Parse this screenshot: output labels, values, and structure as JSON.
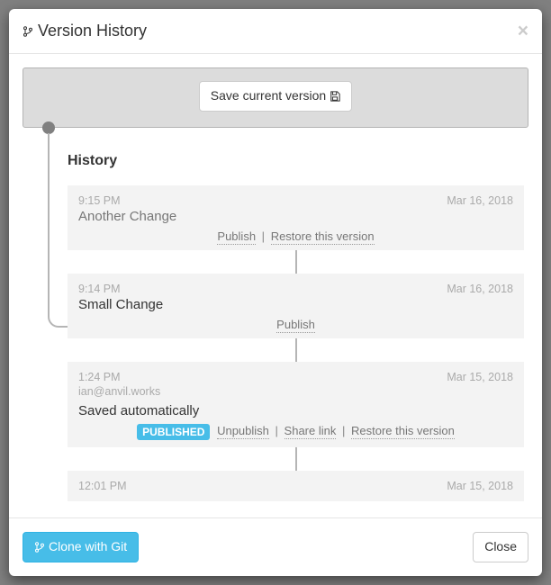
{
  "modal": {
    "title": "Version History",
    "close_glyph": "×"
  },
  "toolbar": {
    "save_label": "Save current version"
  },
  "history": {
    "heading": "History",
    "entries": [
      {
        "time": "9:15 PM",
        "date": "Mar 16, 2018",
        "title": "Another Change",
        "author": "",
        "published": false,
        "current": false
      },
      {
        "time": "9:14 PM",
        "date": "Mar 16, 2018",
        "title": "Small Change",
        "author": "",
        "published": false,
        "current": true
      },
      {
        "time": "1:24 PM",
        "date": "Mar 15, 2018",
        "title": "Saved automatically",
        "author": "ian@anvil.works",
        "published": true,
        "current": false
      },
      {
        "time": "12:01 PM",
        "date": "Mar 15, 2018",
        "title": "",
        "author": "",
        "published": false,
        "current": false
      }
    ]
  },
  "labels": {
    "publish": "Publish",
    "unpublish": "Unpublish",
    "restore": "Restore this version",
    "share": "Share link",
    "published_badge": "PUBLISHED"
  },
  "footer": {
    "clone_label": "Clone with Git",
    "close_label": "Close"
  }
}
